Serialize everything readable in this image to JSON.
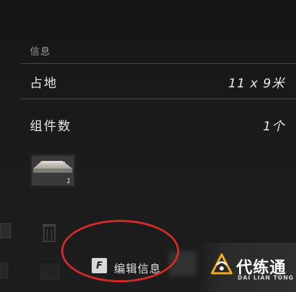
{
  "info": {
    "section_title": "信息",
    "rows": [
      {
        "label": "占地",
        "value": "11 x 9米"
      },
      {
        "label": "组件数",
        "value": "1个"
      }
    ]
  },
  "component": {
    "count": "1"
  },
  "action": {
    "key": "F",
    "label": "编辑信息"
  },
  "watermark": {
    "name": "代练通",
    "sub": "DAI LIAN TONG"
  },
  "colors": {
    "highlight": "#d42a2a",
    "logo_accent": "#f2b01e"
  },
  "icons": [
    "trash-icon",
    "grid-icon",
    "logo-mark-icon"
  ]
}
